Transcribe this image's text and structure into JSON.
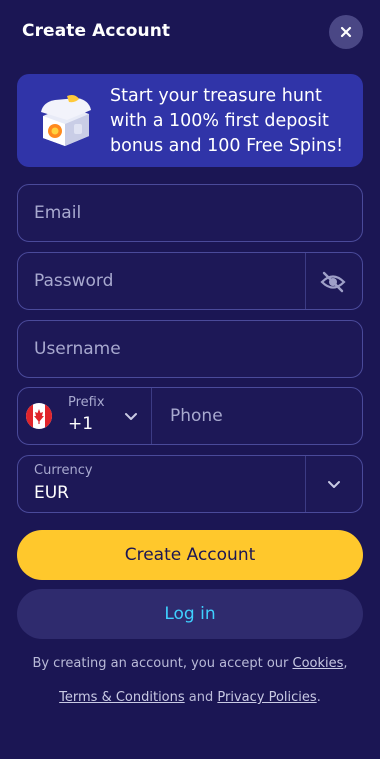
{
  "header": {
    "title": "Create Account",
    "close_icon": "close-icon"
  },
  "banner": {
    "text": "Start your treasure hunt with a 100% first deposit bonus and 100 Free Spins!",
    "image_icon": "treasure-chest-icon"
  },
  "form": {
    "email_placeholder": "Email",
    "password_placeholder": "Password",
    "password_toggle_icon": "eye-off-icon",
    "username_placeholder": "Username",
    "prefix_label": "Prefix",
    "prefix_value": "+1",
    "prefix_flag_icon": "canada-flag-icon",
    "phone_placeholder": "Phone",
    "currency_label": "Currency",
    "currency_value": "EUR"
  },
  "actions": {
    "create_label": "Create Account",
    "login_label": "Log in"
  },
  "legal": {
    "prefix_text": "By creating an account, you accept our ",
    "cookies_link": "Cookies",
    "comma": ",",
    "terms_link": "Terms & Conditions",
    "and_text": " and ",
    "privacy_link": "Privacy Policies",
    "period": "."
  },
  "colors": {
    "background": "#1b1654",
    "banner": "#3034a8",
    "primary_button": "#ffc82c",
    "secondary_button": "#2f2b6e",
    "login_text": "#3fd0ff",
    "field_border": "#4a4a9a"
  }
}
